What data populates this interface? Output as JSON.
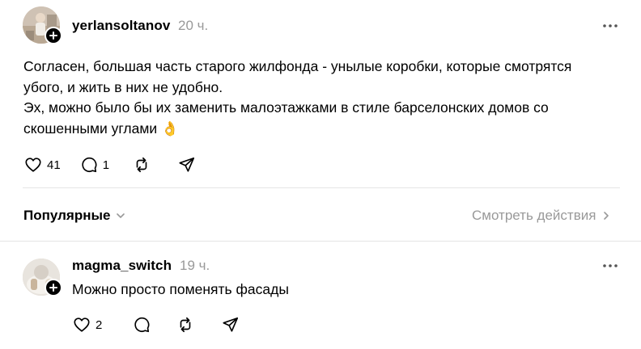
{
  "post": {
    "username": "yerlansoltanov",
    "time": "20 ч.",
    "lines": [
      "Согласен, большая часть старого жилфонда - унылые коробки, которые смотрятся",
      "убого, и жить в них не удобно.",
      "Эх, можно было бы их заменить малоэтажками в стиле барселонских домов со",
      "скошенными углами 👌"
    ],
    "likes": "41",
    "replies": "1"
  },
  "sort": {
    "label": "Популярные"
  },
  "activity": {
    "label": "Смотреть действия"
  },
  "reply": {
    "username": "magma_switch",
    "time": "19 ч.",
    "text": "Можно просто поменять фасады",
    "likes": "2"
  },
  "colors": {
    "text": "#000000",
    "muted": "#999999",
    "divider": "#e5e5e5",
    "background": "#ffffff"
  },
  "icons": [
    "heart-icon",
    "comment-icon",
    "repost-icon",
    "share-icon",
    "more-icon",
    "plus-icon",
    "chevron-down-icon",
    "chevron-right-icon"
  ]
}
